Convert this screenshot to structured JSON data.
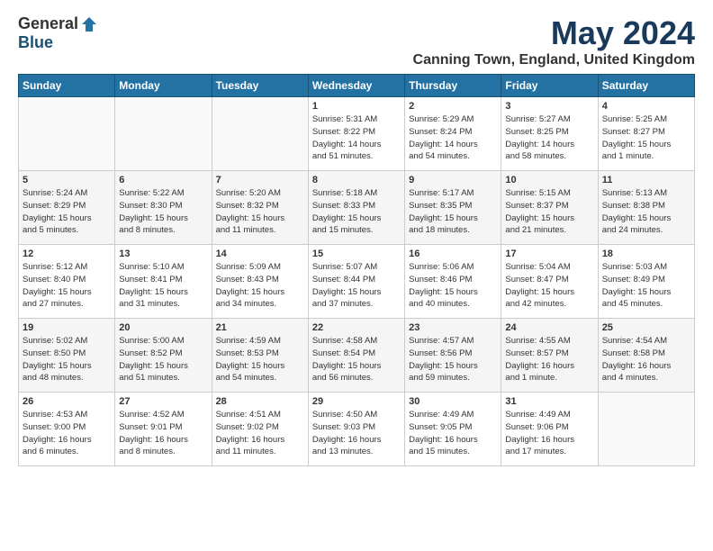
{
  "logo": {
    "general": "General",
    "blue": "Blue"
  },
  "title": "May 2024",
  "location": "Canning Town, England, United Kingdom",
  "headers": [
    "Sunday",
    "Monday",
    "Tuesday",
    "Wednesday",
    "Thursday",
    "Friday",
    "Saturday"
  ],
  "weeks": [
    [
      {
        "day": "",
        "info": ""
      },
      {
        "day": "",
        "info": ""
      },
      {
        "day": "",
        "info": ""
      },
      {
        "day": "1",
        "info": "Sunrise: 5:31 AM\nSunset: 8:22 PM\nDaylight: 14 hours\nand 51 minutes."
      },
      {
        "day": "2",
        "info": "Sunrise: 5:29 AM\nSunset: 8:24 PM\nDaylight: 14 hours\nand 54 minutes."
      },
      {
        "day": "3",
        "info": "Sunrise: 5:27 AM\nSunset: 8:25 PM\nDaylight: 14 hours\nand 58 minutes."
      },
      {
        "day": "4",
        "info": "Sunrise: 5:25 AM\nSunset: 8:27 PM\nDaylight: 15 hours\nand 1 minute."
      }
    ],
    [
      {
        "day": "5",
        "info": "Sunrise: 5:24 AM\nSunset: 8:29 PM\nDaylight: 15 hours\nand 5 minutes."
      },
      {
        "day": "6",
        "info": "Sunrise: 5:22 AM\nSunset: 8:30 PM\nDaylight: 15 hours\nand 8 minutes."
      },
      {
        "day": "7",
        "info": "Sunrise: 5:20 AM\nSunset: 8:32 PM\nDaylight: 15 hours\nand 11 minutes."
      },
      {
        "day": "8",
        "info": "Sunrise: 5:18 AM\nSunset: 8:33 PM\nDaylight: 15 hours\nand 15 minutes."
      },
      {
        "day": "9",
        "info": "Sunrise: 5:17 AM\nSunset: 8:35 PM\nDaylight: 15 hours\nand 18 minutes."
      },
      {
        "day": "10",
        "info": "Sunrise: 5:15 AM\nSunset: 8:37 PM\nDaylight: 15 hours\nand 21 minutes."
      },
      {
        "day": "11",
        "info": "Sunrise: 5:13 AM\nSunset: 8:38 PM\nDaylight: 15 hours\nand 24 minutes."
      }
    ],
    [
      {
        "day": "12",
        "info": "Sunrise: 5:12 AM\nSunset: 8:40 PM\nDaylight: 15 hours\nand 27 minutes."
      },
      {
        "day": "13",
        "info": "Sunrise: 5:10 AM\nSunset: 8:41 PM\nDaylight: 15 hours\nand 31 minutes."
      },
      {
        "day": "14",
        "info": "Sunrise: 5:09 AM\nSunset: 8:43 PM\nDaylight: 15 hours\nand 34 minutes."
      },
      {
        "day": "15",
        "info": "Sunrise: 5:07 AM\nSunset: 8:44 PM\nDaylight: 15 hours\nand 37 minutes."
      },
      {
        "day": "16",
        "info": "Sunrise: 5:06 AM\nSunset: 8:46 PM\nDaylight: 15 hours\nand 40 minutes."
      },
      {
        "day": "17",
        "info": "Sunrise: 5:04 AM\nSunset: 8:47 PM\nDaylight: 15 hours\nand 42 minutes."
      },
      {
        "day": "18",
        "info": "Sunrise: 5:03 AM\nSunset: 8:49 PM\nDaylight: 15 hours\nand 45 minutes."
      }
    ],
    [
      {
        "day": "19",
        "info": "Sunrise: 5:02 AM\nSunset: 8:50 PM\nDaylight: 15 hours\nand 48 minutes."
      },
      {
        "day": "20",
        "info": "Sunrise: 5:00 AM\nSunset: 8:52 PM\nDaylight: 15 hours\nand 51 minutes."
      },
      {
        "day": "21",
        "info": "Sunrise: 4:59 AM\nSunset: 8:53 PM\nDaylight: 15 hours\nand 54 minutes."
      },
      {
        "day": "22",
        "info": "Sunrise: 4:58 AM\nSunset: 8:54 PM\nDaylight: 15 hours\nand 56 minutes."
      },
      {
        "day": "23",
        "info": "Sunrise: 4:57 AM\nSunset: 8:56 PM\nDaylight: 15 hours\nand 59 minutes."
      },
      {
        "day": "24",
        "info": "Sunrise: 4:55 AM\nSunset: 8:57 PM\nDaylight: 16 hours\nand 1 minute."
      },
      {
        "day": "25",
        "info": "Sunrise: 4:54 AM\nSunset: 8:58 PM\nDaylight: 16 hours\nand 4 minutes."
      }
    ],
    [
      {
        "day": "26",
        "info": "Sunrise: 4:53 AM\nSunset: 9:00 PM\nDaylight: 16 hours\nand 6 minutes."
      },
      {
        "day": "27",
        "info": "Sunrise: 4:52 AM\nSunset: 9:01 PM\nDaylight: 16 hours\nand 8 minutes."
      },
      {
        "day": "28",
        "info": "Sunrise: 4:51 AM\nSunset: 9:02 PM\nDaylight: 16 hours\nand 11 minutes."
      },
      {
        "day": "29",
        "info": "Sunrise: 4:50 AM\nSunset: 9:03 PM\nDaylight: 16 hours\nand 13 minutes."
      },
      {
        "day": "30",
        "info": "Sunrise: 4:49 AM\nSunset: 9:05 PM\nDaylight: 16 hours\nand 15 minutes."
      },
      {
        "day": "31",
        "info": "Sunrise: 4:49 AM\nSunset: 9:06 PM\nDaylight: 16 hours\nand 17 minutes."
      },
      {
        "day": "",
        "info": ""
      }
    ]
  ]
}
